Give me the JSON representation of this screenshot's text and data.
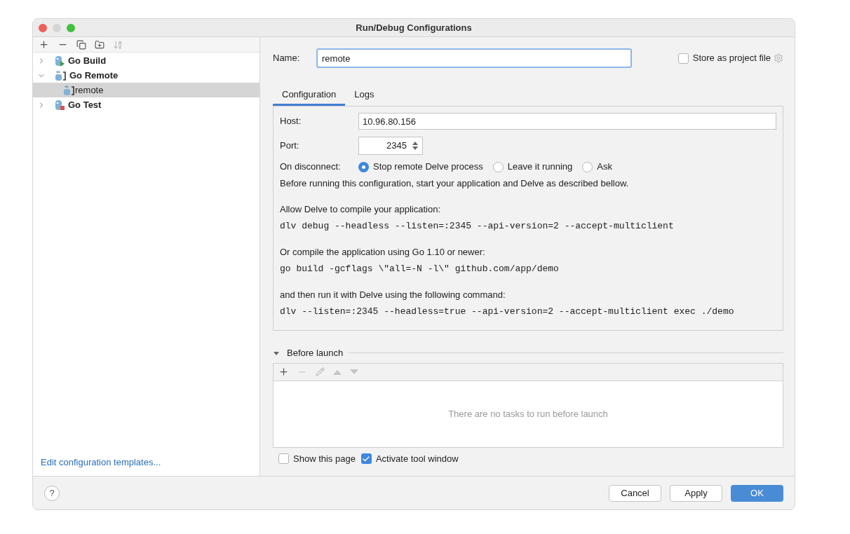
{
  "window": {
    "title": "Run/Debug Configurations"
  },
  "tree": [
    {
      "label": "Go Build",
      "kind": "build",
      "expanded": false,
      "selected": false
    },
    {
      "label": "Go Remote",
      "kind": "remote",
      "expanded": true,
      "selected": false,
      "children": [
        {
          "label": "remote",
          "kind": "remote",
          "selected": true
        }
      ]
    },
    {
      "label": "Go Test",
      "kind": "test",
      "expanded": false,
      "selected": false
    }
  ],
  "templates_link": "Edit configuration templates...",
  "name_label": "Name:",
  "name_value": "remote",
  "store_project": {
    "label": "Store as project file",
    "checked": false
  },
  "tabs": [
    {
      "label": "Configuration",
      "selected": true
    },
    {
      "label": "Logs",
      "selected": false
    }
  ],
  "host": {
    "label": "Host:",
    "value": "10.96.80.156"
  },
  "port": {
    "label": "Port:",
    "value": "2345"
  },
  "disconnect": {
    "label": "On disconnect:",
    "options": [
      {
        "label": "Stop remote Delve process",
        "selected": true
      },
      {
        "label": "Leave it running",
        "selected": false
      },
      {
        "label": "Ask",
        "selected": false
      }
    ]
  },
  "intro": "Before running this configuration, start your application and Delve as described bellow.",
  "sections": [
    {
      "text": "Allow Delve to compile your application:",
      "code": "dlv debug --headless --listen=:2345 --api-version=2 --accept-multiclient"
    },
    {
      "text": "Or compile the application using Go 1.10 or newer:",
      "code": "go build -gcflags \\\"all=-N -l\\\" github.com/app/demo"
    },
    {
      "text": "and then run it with Delve using the following command:",
      "code": "dlv --listen=:2345 --headless=true --api-version=2 --accept-multiclient exec ./demo"
    }
  ],
  "before_launch": {
    "title": "Before launch",
    "expanded": true,
    "empty_text": "There are no tasks to run before launch"
  },
  "options": [
    {
      "label": "Show this page",
      "checked": false
    },
    {
      "label": "Activate tool window",
      "checked": true
    }
  ],
  "help": "?",
  "buttons": [
    {
      "label": "Cancel",
      "primary": false
    },
    {
      "label": "Apply",
      "primary": false
    },
    {
      "label": "OK",
      "primary": true
    }
  ]
}
